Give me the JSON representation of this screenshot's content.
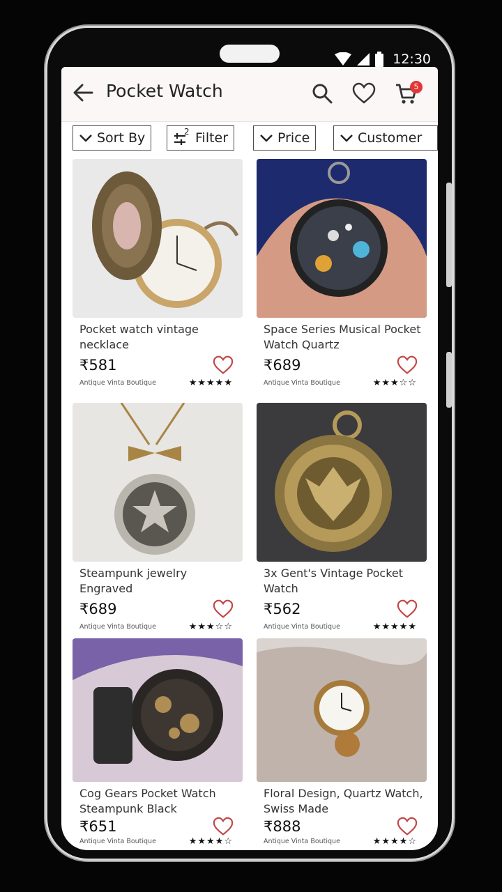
{
  "status": {
    "time": "12:30"
  },
  "header": {
    "title": "Pocket Watch",
    "cart_count": "5"
  },
  "filters": {
    "sort": "Sort By",
    "filter": "Filter",
    "filter_count": "2",
    "price": "Price",
    "customer": "Customer"
  },
  "products": [
    {
      "name": "Pocket watch vintage necklace",
      "price": "₹581",
      "store": "Antique Vinta Boutique",
      "stars": "★★★★★",
      "rating": 5
    },
    {
      "name": "Space Series Musical Pocket Watch Quartz",
      "price": "₹689",
      "store": "Antique Vinta Boutique",
      "stars": "★★★☆☆",
      "rating": 3
    },
    {
      "name": "Steampunk jewelry Engraved",
      "price": "₹689",
      "store": "Antique Vinta Boutique",
      "stars": "★★★☆☆",
      "rating": 3
    },
    {
      "name": "3x Gent's Vintage Pocket Watch",
      "price": "₹562",
      "store": "Antique Vinta Boutique",
      "stars": "★★★★★",
      "rating": 5
    },
    {
      "name": "Cog Gears Pocket Watch Steampunk Black",
      "price": "₹651",
      "store": "Antique Vinta Boutique",
      "stars": "★★★★☆",
      "rating": 4
    },
    {
      "name": "Floral Design, Quartz Watch, Swiss Made",
      "price": "₹888",
      "store": "Antique Vinta Boutique",
      "stars": "★★★★☆",
      "rating": 4
    }
  ],
  "colors": {
    "accent": "#e33636",
    "heart": "#c24848",
    "appbar": "#fbf7f7"
  },
  "icons": [
    "back-arrow-icon",
    "search-icon",
    "heart-icon",
    "cart-icon",
    "chevron-down-icon",
    "filter-icon"
  ]
}
